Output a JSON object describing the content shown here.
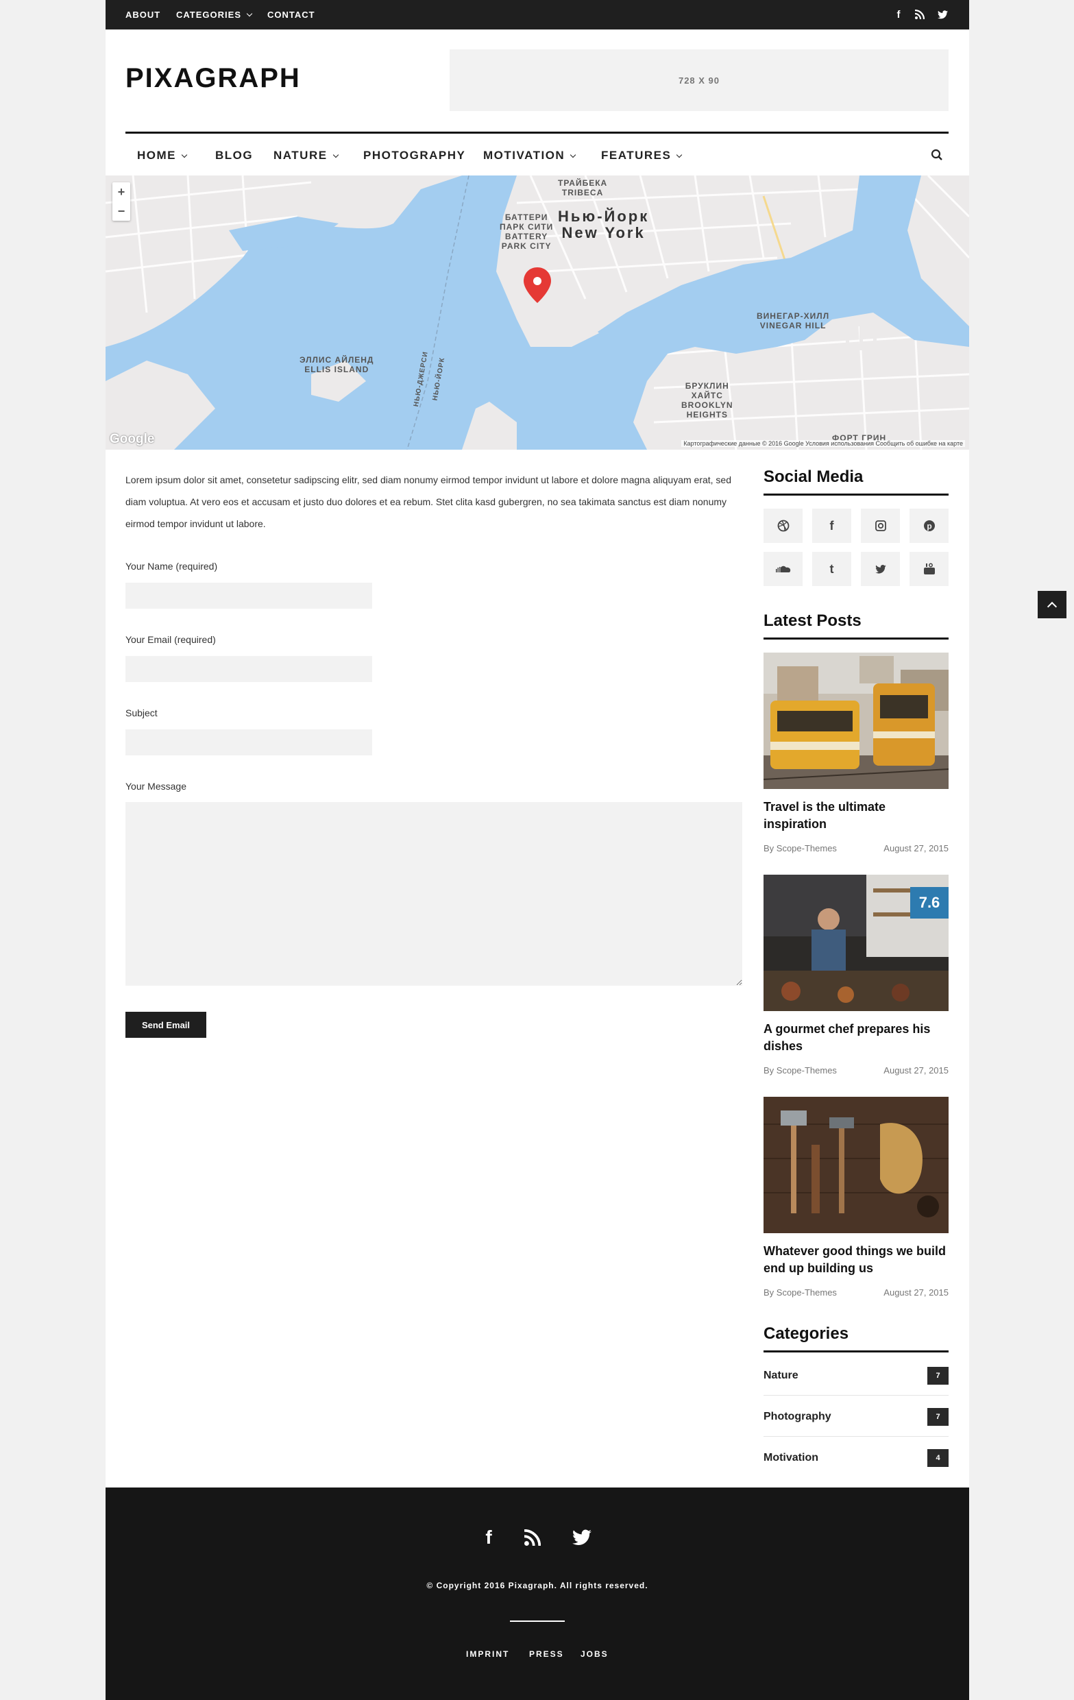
{
  "topbar": {
    "links": [
      {
        "label": "ABOUT"
      },
      {
        "label": "CATEGORIES"
      },
      {
        "label": "CONTACT"
      }
    ],
    "social_icons": [
      "facebook-icon",
      "rss-icon",
      "twitter-icon"
    ]
  },
  "header": {
    "logo": "PIXAGRAPH",
    "ad_label": "728 X 90"
  },
  "nav": {
    "items": [
      {
        "label": "HOME",
        "has_dropdown": true
      },
      {
        "label": "BLOG",
        "has_dropdown": false
      },
      {
        "label": "NATURE",
        "has_dropdown": true
      },
      {
        "label": "PHOTOGRAPHY",
        "has_dropdown": false
      },
      {
        "label": "MOTIVATION",
        "has_dropdown": true
      },
      {
        "label": "FEATURES",
        "has_dropdown": true
      }
    ],
    "search_icon": "search-icon"
  },
  "map": {
    "labels": {
      "tribeca": "ТРАЙБЕКА\nTRIBECA",
      "battery": "БАТТЕРИ\nПАРК СИТИ\nBATTERY\nPARK CITY",
      "newyork": "Нью-Йорк\nNew York",
      "ellis": "ЭЛЛИС АЙЛЕНД\nELLIS ISLAND",
      "vinegar": "ВИНЕГАР-ХИЛЛ\nVINEGAR HILL",
      "brooklyn": "БРУКЛИН\nХАЙТС\nBROOKLYN\nHEIGHTS",
      "fort": "ФОРТ ГРИН",
      "nj": "НЬЮ-ДЖЕРСИ",
      "ny": "НЬЮ-ЙОРК"
    },
    "google": "Google",
    "attribution": "Картографические данные © 2016 Google   Условия использования   Сообщить об ошибке на карте",
    "zoom_in": "+",
    "zoom_out": "−",
    "water_color": "#a3cdf0",
    "land_color": "#eceaea",
    "pin_color": "#e53935"
  },
  "content": {
    "intro": "Lorem ipsum dolor sit amet, consetetur sadipscing elitr, sed diam nonumy eirmod tempor invidunt ut labore et dolore magna aliquyam erat, sed diam voluptua. At vero eos et accusam et justo duo dolores et ea rebum. Stet clita kasd gubergren, no sea takimata sanctus est diam nonumy eirmod tempor invidunt ut labore.",
    "form": {
      "name_label": "Your Name (required)",
      "email_label": "Your Email (required)",
      "subject_label": "Subject",
      "message_label": "Your Message",
      "submit": "Send Email"
    }
  },
  "sidebar": {
    "social_title": "Social Media",
    "social": [
      "dribbble-icon",
      "facebook-icon",
      "instagram-icon",
      "pinterest-icon",
      "soundcloud-icon",
      "tumblr-icon",
      "twitter-icon",
      "youtube-icon"
    ],
    "latest_title": "Latest Posts",
    "posts": [
      {
        "title": "Travel is the ultimate inspiration",
        "author": "By Scope-Themes",
        "date": "August 27, 2015"
      },
      {
        "title": "A gourmet chef prepares his dishes",
        "author": "By Scope-Themes",
        "date": "August 27, 2015",
        "score": "7.6"
      },
      {
        "title": "Whatever good things we build end up building us",
        "author": "By Scope-Themes",
        "date": "August 27, 2015"
      }
    ],
    "categories_title": "Categories",
    "categories": [
      {
        "name": "Nature",
        "count": "7"
      },
      {
        "name": "Photography",
        "count": "7"
      },
      {
        "name": "Motivation",
        "count": "4"
      }
    ]
  },
  "footer": {
    "social": [
      "facebook-icon",
      "rss-icon",
      "twitter-icon"
    ],
    "copyright": "© Copyright 2016 Pixagraph. All rights reserved.",
    "links": [
      {
        "label": "IMPRINT"
      },
      {
        "label": "PRESS"
      },
      {
        "label": "JOBS"
      }
    ]
  }
}
